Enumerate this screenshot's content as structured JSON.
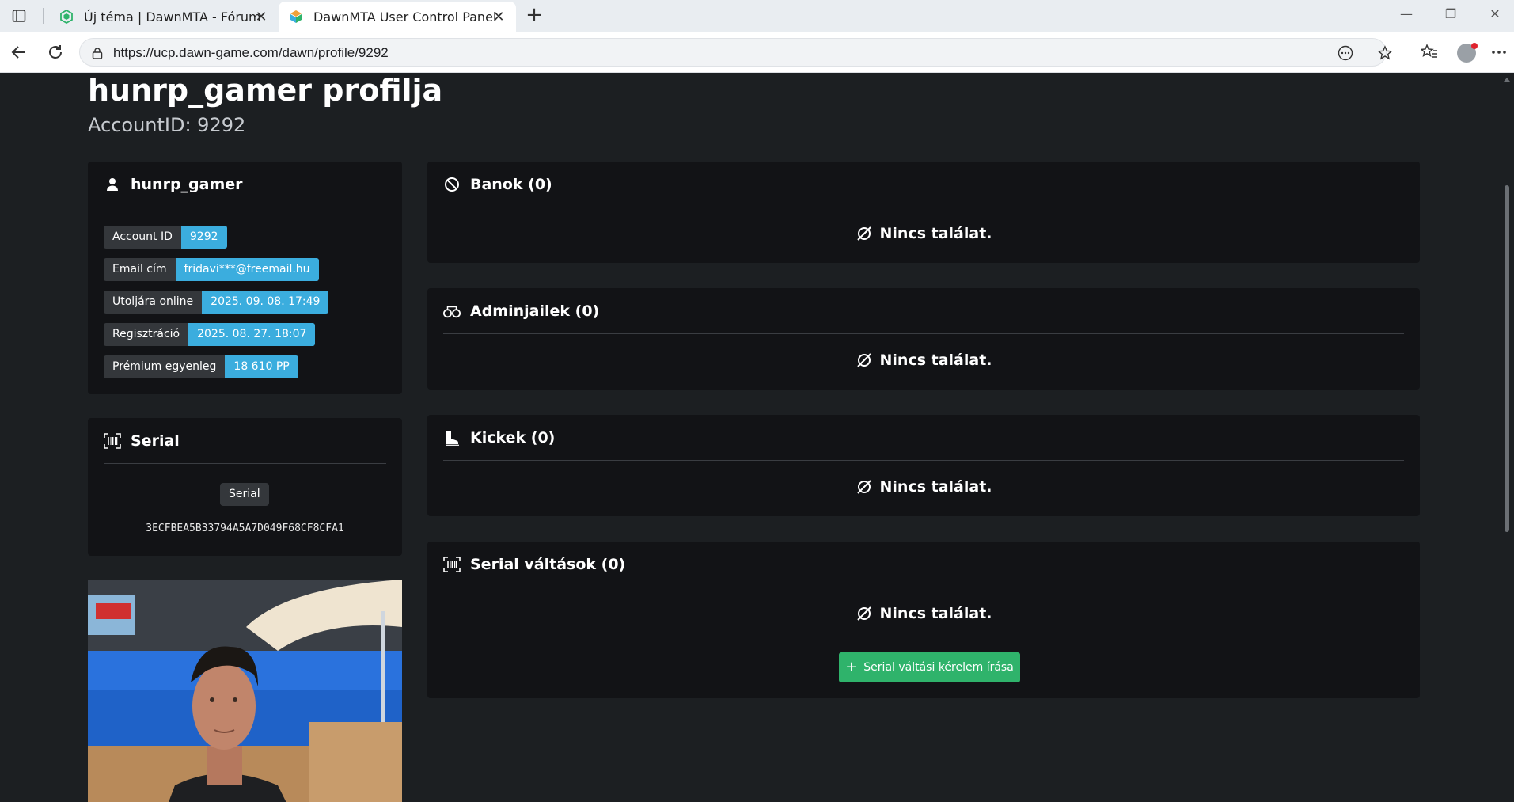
{
  "browser": {
    "tabs": [
      {
        "title": "Új téma | DawnMTA - Fórum",
        "active": false
      },
      {
        "title": "DawnMTA User Control Panel",
        "active": true
      }
    ],
    "url": "https://ucp.dawn-game.com/dawn/profile/9292"
  },
  "page": {
    "title": "hunrp_gamer profilja",
    "subtitle": "AccountID: 9292"
  },
  "user_card": {
    "username": "hunrp_gamer",
    "rows": [
      {
        "label": "Account ID",
        "value": "9292"
      },
      {
        "label": "Email cím",
        "value": "fridavi***@freemail.hu"
      },
      {
        "label": "Utoljára online",
        "value": "2025. 09. 08. 17:49"
      },
      {
        "label": "Regisztráció",
        "value": "2025. 08. 27. 18:07"
      },
      {
        "label": "Prémium egyenleg",
        "value": "18 610 PP"
      }
    ]
  },
  "serial_card": {
    "title": "Serial",
    "badge": "Serial",
    "value": "3ECFBEA5B33794A5A7D049F68CF8CFA1"
  },
  "sections": [
    {
      "title": "Banok (0)",
      "icon": "ban-icon",
      "empty": "Nincs találat."
    },
    {
      "title": "Adminjailek (0)",
      "icon": "handcuffs-icon",
      "empty": "Nincs találat."
    },
    {
      "title": "Kickek (0)",
      "icon": "boot-icon",
      "empty": "Nincs találat."
    },
    {
      "title": "Serial váltások (0)",
      "icon": "barcode-icon",
      "empty": "Nincs találat.",
      "button": "Serial váltási kérelem írása"
    }
  ],
  "colors": {
    "page_bg": "#1c1f22",
    "card_bg": "#121316",
    "label_bg": "#34373b",
    "value_bg": "#3badde",
    "button_green": "#2fb36b"
  }
}
